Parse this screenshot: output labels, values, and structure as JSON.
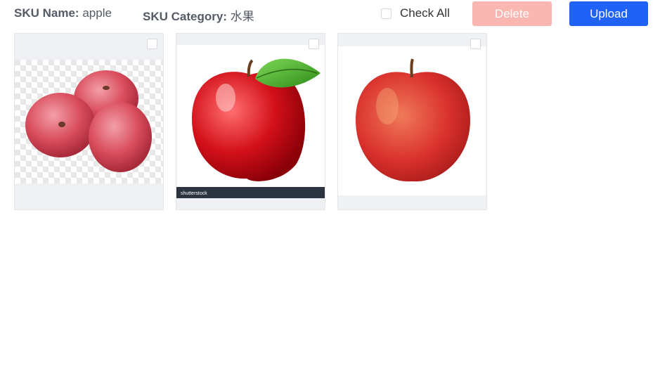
{
  "sku": {
    "name_label": "SKU Name:",
    "name_value": "apple",
    "category_label": "SKU Category:",
    "category_value": "水果"
  },
  "actions": {
    "check_all_label": "Check All",
    "delete_label": "Delete",
    "upload_label": "Upload"
  },
  "images": [
    {
      "description": "apple-group-icon",
      "checked": false
    },
    {
      "description": "apple-with-leaf-icon",
      "checked": false,
      "watermark": "shutterstock"
    },
    {
      "description": "apple-single-icon",
      "checked": false
    }
  ],
  "colors": {
    "delete_bg": "#fab6b1",
    "upload_bg": "#1f62f5",
    "card_bg": "#f0f1f4"
  }
}
